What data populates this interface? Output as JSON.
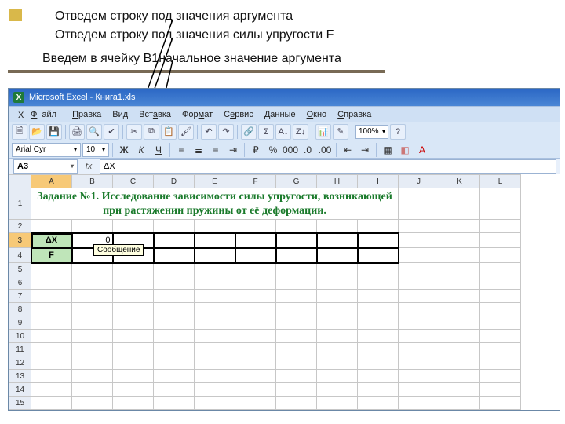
{
  "annotations": {
    "a1": "Отведем строку под значения аргумента",
    "a2": "Отведем строку под значения силы упругости F",
    "a3": "Введем в ячейку B1начальное значение аргумента"
  },
  "window": {
    "title": "Microsoft Excel - Книга1.xls"
  },
  "menu": {
    "file": "Файл",
    "edit": "Правка",
    "view": "Вид",
    "insert": "Вставка",
    "format": "Формат",
    "tools": "Сервис",
    "data": "Данные",
    "window": "Окно",
    "help": "Справка"
  },
  "toolbar": {
    "zoom": "100%"
  },
  "fmt": {
    "font": "Arial Cyr",
    "size": "10",
    "tooltip": "Сообщение"
  },
  "fx": {
    "name": "A3",
    "formula": "ΔX"
  },
  "cols": [
    "A",
    "B",
    "C",
    "D",
    "E",
    "F",
    "G",
    "H",
    "I",
    "J",
    "K",
    "L"
  ],
  "rows": [
    "1",
    "2",
    "3",
    "4",
    "5",
    "6",
    "7",
    "8",
    "9",
    "10",
    "11",
    "12",
    "13",
    "14",
    "15"
  ],
  "task": "Задание №1.  Исследование зависимости силы упругости, возникающей при растяжении пружины от её деформации.",
  "cells": {
    "a3": "ΔX",
    "b3": "0",
    "a4": "F"
  }
}
